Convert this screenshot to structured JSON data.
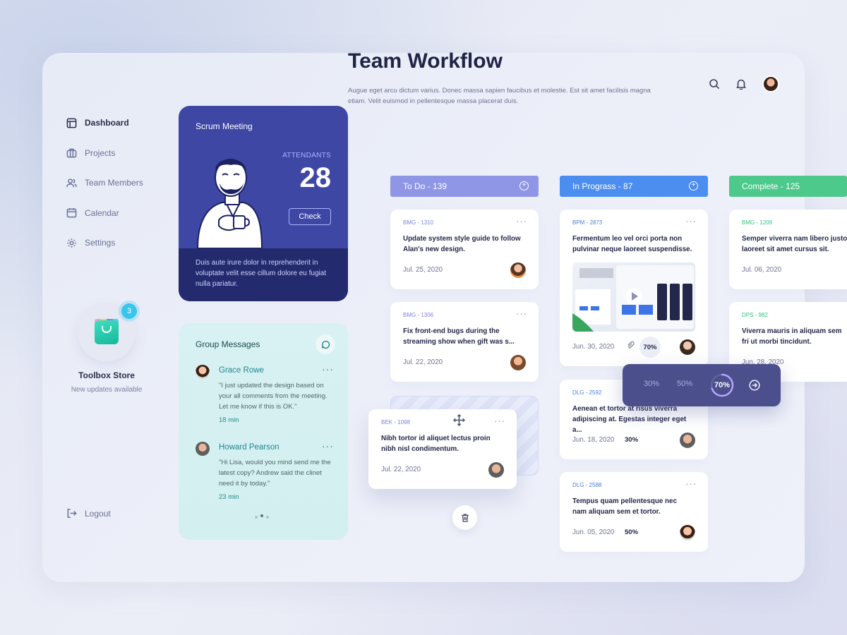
{
  "sidebar": {
    "items": [
      {
        "label": "Dashboard",
        "active": true
      },
      {
        "label": "Projects"
      },
      {
        "label": "Team Members"
      },
      {
        "label": "Calendar"
      },
      {
        "label": "Settings"
      }
    ],
    "store": {
      "badge": "3",
      "title": "Toolbox Store",
      "subtitle": "New updates available"
    },
    "logout": "Logout"
  },
  "scrum": {
    "title": "Scrum Meeting",
    "attendants_label": "ATTENDANTS",
    "attendants": "28",
    "check": "Check",
    "footer": "Duis aute irure dolor in reprehenderit in voluptate velit esse cillum dolore eu fugiat nulla pariatur."
  },
  "group_messages": {
    "title": "Group Messages",
    "messages": [
      {
        "name": "Grace Rowe",
        "text": "\"I just updated the design based on your all comments from the meeting. Let me know if this is OK.\"",
        "time": "18 min"
      },
      {
        "name": "Howard Pearson",
        "text": "\"Hi Lisa, would you mind send me the latest copy? Andrew said the clinet need it by today.\"",
        "time": "23 min"
      }
    ]
  },
  "header": {
    "title": "Team Workflow",
    "description": "Augue eget arcu dictum varius. Donec massa sapien faucibus et molestie. Est sit amet facilisis magna etiam. Velit euismod in pellentesque massa placerat duis."
  },
  "columns": [
    {
      "label": "To Do  -  139",
      "color": "#8f96e6",
      "cards": [
        {
          "code": "BMG - 1310",
          "title": "Update system style guide to follow Alan's new design.",
          "date": "Jul. 25, 2020"
        },
        {
          "code": "BMG - 1306",
          "title": "Fix front-end bugs during the streaming show when gift was s...",
          "date": "Jul. 22, 2020"
        }
      ]
    },
    {
      "label": "In Prograss  -  87",
      "color": "#4c8ef0",
      "cards": [
        {
          "code": "BPM - 2873",
          "title": "Fermentum leo vel orci porta non pulvinar neque laoreet suspendisse.",
          "date": "Jun. 30, 2020",
          "pct": "70%"
        },
        {
          "code": "DLG - 2592",
          "title": "Aenean et tortor at risus viverra adipiscing at. Egestas integer eget a...",
          "date": "Jun. 18, 2020",
          "pct": "30%"
        },
        {
          "code": "DLG - 2588",
          "title": "Tempus quam pellentesque nec nam aliquam sem et tortor.",
          "date": "Jun. 05, 2020",
          "pct": "50%"
        }
      ]
    },
    {
      "label": "Complete  -  125",
      "color": "#4cc98b",
      "cards": [
        {
          "code": "BMG - 1209",
          "title": "Semper viverra nam libero justo laoreet sit amet cursus sit.",
          "date": "Jul. 06, 2020"
        },
        {
          "code": "DPS - 982",
          "title": "Viverra mauris in aliquam sem fri ut morbi tincidunt.",
          "date": "Jun. 28, 2020"
        }
      ]
    }
  ],
  "dragging_card": {
    "code": "BEK - 1098",
    "title": "Nibh tortor id aliquet lectus proin nibh nisl condimentum.",
    "date": "Jul. 22, 2020"
  },
  "progress_picker": {
    "options": [
      "30%",
      "50%",
      "70%"
    ],
    "selected": "70%",
    "selected_fraction": 0.7
  },
  "icons": {
    "search": "search-icon",
    "bell": "bell-icon",
    "trash": "trash-icon",
    "move": "move-icon",
    "chat": "chat-icon"
  }
}
